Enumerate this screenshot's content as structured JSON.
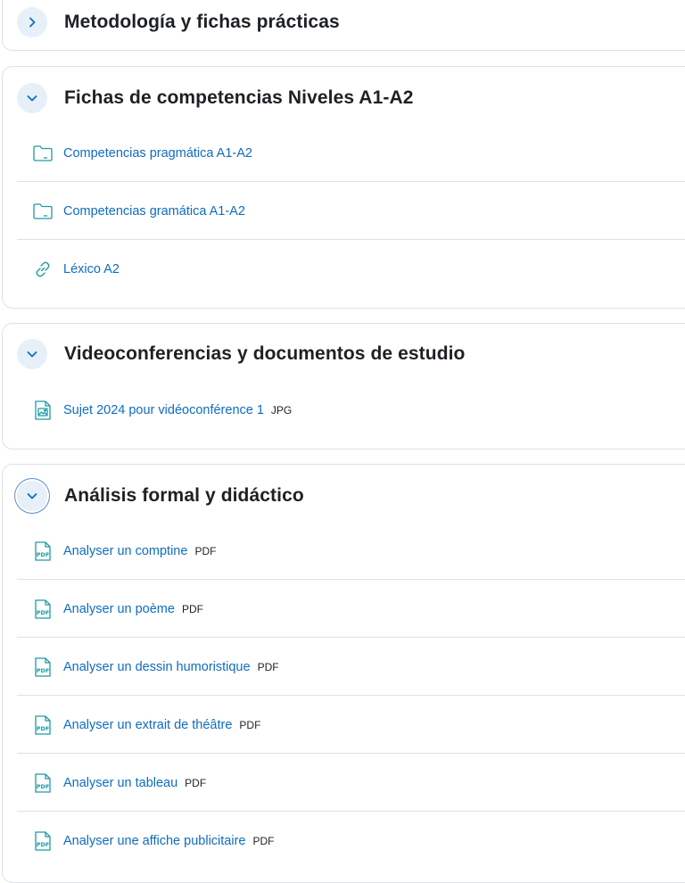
{
  "colors": {
    "link": "#0f6cbf",
    "border": "#dee2e6",
    "toggle_bg": "#e7f0f9",
    "icon": "#1e9aa6"
  },
  "sections": [
    {
      "title": "Metodología y fichas prácticas",
      "toggle_icon": "chevron-right-icon",
      "activities": []
    },
    {
      "title": "Fichas de competencias Niveles A1-A2",
      "toggle_icon": "chevron-down-icon",
      "activities": [
        {
          "label": "Competencias pragmática A1-A2",
          "icon": "folder-icon",
          "type": ""
        },
        {
          "label": "Competencias gramática A1-A2",
          "icon": "folder-icon",
          "type": ""
        },
        {
          "label": "Léxico A2",
          "icon": "link-icon",
          "type": ""
        }
      ]
    },
    {
      "title": "Videoconferencias y documentos de estudio",
      "toggle_icon": "chevron-down-icon",
      "activities": [
        {
          "label": "Sujet 2024 pour vidéoconférence 1",
          "icon": "image-file-icon",
          "type": "JPG"
        }
      ]
    },
    {
      "title": "Análisis formal y didáctico",
      "toggle_icon": "chevron-down-icon",
      "activities": [
        {
          "label": "Analyser un comptine",
          "icon": "pdf-icon",
          "type": "PDF"
        },
        {
          "label": "Analyser un poème",
          "icon": "pdf-icon",
          "type": "PDF"
        },
        {
          "label": "Analyser un dessin humoristique",
          "icon": "pdf-icon",
          "type": "PDF"
        },
        {
          "label": "Analyser un extrait de théâtre",
          "icon": "pdf-icon",
          "type": "PDF"
        },
        {
          "label": "Analyser un tableau",
          "icon": "pdf-icon",
          "type": "PDF"
        },
        {
          "label": "Analyser une affiche publicitaire",
          "icon": "pdf-icon",
          "type": "PDF"
        }
      ]
    }
  ]
}
